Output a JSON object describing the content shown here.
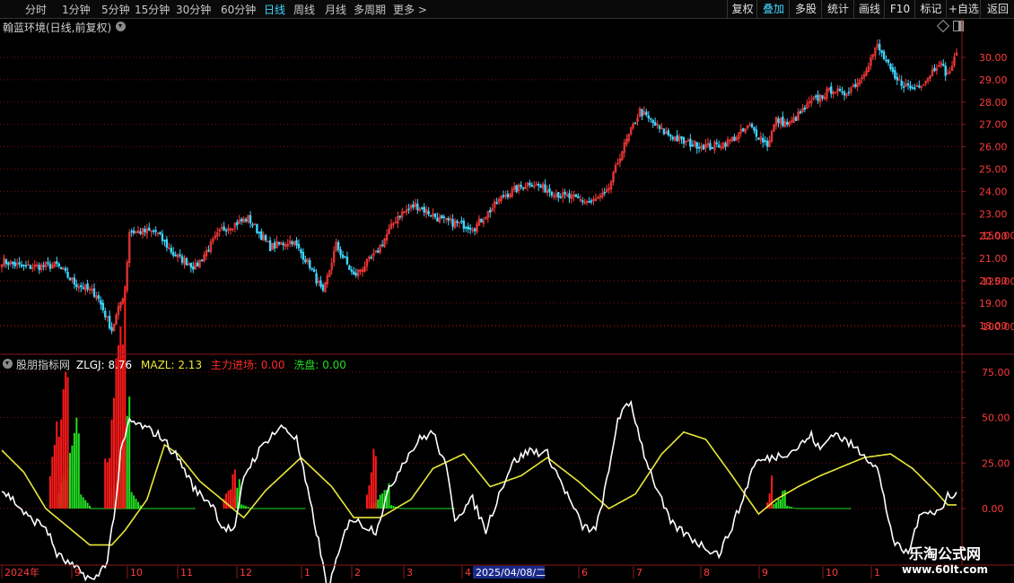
{
  "toolbar": {
    "periods": [
      "分时",
      "1分钟",
      "5分钟",
      "15分钟",
      "30分钟",
      "60分钟",
      "日线",
      "周线",
      "月线",
      "多周期",
      "更多 >"
    ],
    "active_period": "日线",
    "right_buttons": [
      "复权",
      "叠加",
      "多股",
      "统计",
      "画线",
      "F10",
      "标记",
      "+自选",
      "返回"
    ],
    "active_right": "叠加"
  },
  "stock": {
    "title": "翰蓝环境(日线,前复权)"
  },
  "indicator": {
    "name": "股朋指标网",
    "zlgj_label": "ZLGJ:",
    "zlgj_value": "8.76",
    "mazl_label": "MAZL:",
    "mazl_value": "2.13",
    "zljc_label": "主力进场:",
    "zljc_value": "0.00",
    "xp_label": "洗盘:",
    "xp_value": "0.00"
  },
  "x_axis": {
    "labels": [
      "2024年",
      "9",
      "10",
      "11",
      "12",
      "1",
      "2",
      "3",
      "4",
      "6",
      "7",
      "8",
      "9",
      "10",
      "1"
    ],
    "cursor_label": "2025/04/08/二"
  },
  "watermark": {
    "line1": "乐淘公式网",
    "line2": "www.60lt.com"
  },
  "colors": {
    "up": "#ff3b3b",
    "down": "#3fd6ff",
    "white_line": "#ffffff",
    "yellow_line": "#e8e83a",
    "red_bar": "#ff1a1a",
    "green_bar": "#22dd22",
    "grid": "#7a1010",
    "axis_text": "#ff3b3b"
  },
  "chart_data": [
    {
      "type": "candlestick",
      "title": "翰蓝环境(日线,前复权)",
      "ylim": [
        17.3,
        31.0
      ],
      "y_ticks": [
        18.0,
        19.0,
        20.0,
        21.0,
        22.0,
        23.0,
        24.0,
        25.0,
        26.0,
        27.0,
        28.0,
        29.0,
        30.0
      ],
      "close_path_key_points": [
        [
          0,
          20.9
        ],
        [
          10,
          20.6
        ],
        [
          25,
          20.7
        ],
        [
          33,
          19.9
        ],
        [
          43,
          19.4
        ],
        [
          50,
          17.8
        ],
        [
          56,
          19.6
        ],
        [
          58,
          22.2
        ],
        [
          70,
          22.2
        ],
        [
          78,
          21.2
        ],
        [
          88,
          20.6
        ],
        [
          100,
          22.3
        ],
        [
          112,
          22.8
        ],
        [
          122,
          21.5
        ],
        [
          132,
          21.8
        ],
        [
          140,
          20.7
        ],
        [
          146,
          19.4
        ],
        [
          152,
          21.6
        ],
        [
          160,
          20.2
        ],
        [
          170,
          21.2
        ],
        [
          180,
          22.9
        ],
        [
          188,
          23.4
        ],
        [
          200,
          22.7
        ],
        [
          215,
          22.4
        ],
        [
          228,
          23.8
        ],
        [
          240,
          24.4
        ],
        [
          255,
          23.8
        ],
        [
          268,
          23.5
        ],
        [
          275,
          23.9
        ],
        [
          278,
          24.7
        ],
        [
          281,
          25.6
        ],
        [
          290,
          27.6
        ],
        [
          300,
          26.7
        ],
        [
          310,
          26.2
        ],
        [
          322,
          26.0
        ],
        [
          330,
          26.2
        ],
        [
          340,
          26.9
        ],
        [
          348,
          26.1
        ],
        [
          352,
          27.2
        ],
        [
          358,
          27.0
        ],
        [
          368,
          28.0
        ],
        [
          378,
          28.6
        ],
        [
          382,
          28.3
        ],
        [
          390,
          29.0
        ],
        [
          398,
          30.5
        ],
        [
          402,
          29.8
        ],
        [
          406,
          29.0
        ],
        [
          414,
          28.6
        ],
        [
          420,
          29.0
        ],
        [
          426,
          29.8
        ],
        [
          430,
          29.2
        ],
        [
          434,
          30.1
        ]
      ]
    },
    {
      "type": "mixed",
      "title": "股朋指标网",
      "ylim": [
        -10,
        155
      ],
      "y_ticks": [
        0.0,
        25.0,
        50.0,
        75.0,
        100.0,
        125.0,
        150.0
      ],
      "series": [
        {
          "name": "ZLGJ",
          "type": "line",
          "last_value": 8.76,
          "key_points": [
            [
              0,
              10
            ],
            [
              5,
              5
            ],
            [
              12,
              -5
            ],
            [
              20,
              -10
            ],
            [
              25,
              -25
            ],
            [
              30,
              -30
            ],
            [
              36,
              -35
            ],
            [
              42,
              -40
            ],
            [
              48,
              -28
            ],
            [
              52,
              5
            ],
            [
              54,
              30
            ],
            [
              58,
              48
            ],
            [
              64,
              45
            ],
            [
              72,
              40
            ],
            [
              80,
              28
            ],
            [
              88,
              10
            ],
            [
              96,
              2
            ],
            [
              100,
              -10
            ],
            [
              106,
              -12
            ],
            [
              110,
              18
            ],
            [
              116,
              30
            ],
            [
              122,
              40
            ],
            [
              128,
              45
            ],
            [
              134,
              38
            ],
            [
              138,
              15
            ],
            [
              144,
              -18
            ],
            [
              148,
              -45
            ],
            [
              152,
              -30
            ],
            [
              158,
              -5
            ],
            [
              166,
              -10
            ],
            [
              170,
              -12
            ],
            [
              176,
              10
            ],
            [
              182,
              25
            ],
            [
              190,
              38
            ],
            [
              196,
              42
            ],
            [
              202,
              22
            ],
            [
              206,
              -5
            ],
            [
              214,
              5
            ],
            [
              220,
              -12
            ],
            [
              226,
              8
            ],
            [
              232,
              25
            ],
            [
              240,
              32
            ],
            [
              248,
              30
            ],
            [
              256,
              10
            ],
            [
              264,
              -10
            ],
            [
              270,
              -12
            ],
            [
              276,
              20
            ],
            [
              280,
              50
            ],
            [
              286,
              58
            ],
            [
              292,
              30
            ],
            [
              298,
              10
            ],
            [
              304,
              -8
            ],
            [
              312,
              -15
            ],
            [
              318,
              -20
            ],
            [
              326,
              -25
            ],
            [
              330,
              -15
            ],
            [
              336,
              2
            ],
            [
              342,
              25
            ],
            [
              350,
              28
            ],
            [
              360,
              32
            ],
            [
              368,
              40
            ],
            [
              372,
              32
            ],
            [
              378,
              42
            ],
            [
              386,
              35
            ],
            [
              392,
              30
            ],
            [
              398,
              22
            ],
            [
              402,
              0
            ],
            [
              406,
              -20
            ],
            [
              412,
              -25
            ],
            [
              416,
              -8
            ],
            [
              420,
              0
            ],
            [
              424,
              -2
            ],
            [
              428,
              0
            ],
            [
              430,
              8
            ]
          ]
        },
        {
          "name": "MAZL",
          "type": "line",
          "last_value": 2.13,
          "key_points": [
            [
              0,
              32
            ],
            [
              10,
              20
            ],
            [
              20,
              0
            ],
            [
              30,
              -10
            ],
            [
              40,
              -20
            ],
            [
              50,
              -20
            ],
            [
              56,
              -12
            ],
            [
              66,
              5
            ],
            [
              74,
              35
            ],
            [
              80,
              30
            ],
            [
              90,
              15
            ],
            [
              100,
              5
            ],
            [
              110,
              -5
            ],
            [
              120,
              10
            ],
            [
              136,
              28
            ],
            [
              150,
              12
            ],
            [
              160,
              -5
            ],
            [
              172,
              -5
            ],
            [
              186,
              5
            ],
            [
              196,
              22
            ],
            [
              210,
              30
            ],
            [
              222,
              12
            ],
            [
              236,
              18
            ],
            [
              248,
              28
            ],
            [
              262,
              15
            ],
            [
              276,
              0
            ],
            [
              288,
              8
            ],
            [
              300,
              30
            ],
            [
              310,
              42
            ],
            [
              320,
              38
            ],
            [
              332,
              18
            ],
            [
              344,
              -3
            ],
            [
              352,
              5
            ],
            [
              362,
              12
            ],
            [
              372,
              18
            ],
            [
              380,
              22
            ],
            [
              392,
              28
            ],
            [
              404,
              30
            ],
            [
              414,
              22
            ],
            [
              424,
              10
            ],
            [
              430,
              2
            ]
          ]
        },
        {
          "name": "主力进场",
          "type": "bar",
          "color": "red",
          "last_value": 0.0,
          "groups": [
            [
              22,
              30,
              120
            ],
            [
              47,
              56,
              148
            ],
            [
              101,
              106,
              28
            ],
            [
              166,
              170,
              48
            ],
            [
              348,
              350,
              25
            ]
          ]
        },
        {
          "name": "洗盘",
          "type": "bar",
          "color": "green",
          "last_value": 0.0,
          "groups": [
            [
              26,
              35,
              62
            ],
            [
              50,
              58,
              72
            ],
            [
              104,
              108,
              18
            ],
            [
              168,
              176,
              15
            ],
            [
              350,
              356,
              12
            ]
          ]
        }
      ]
    }
  ]
}
